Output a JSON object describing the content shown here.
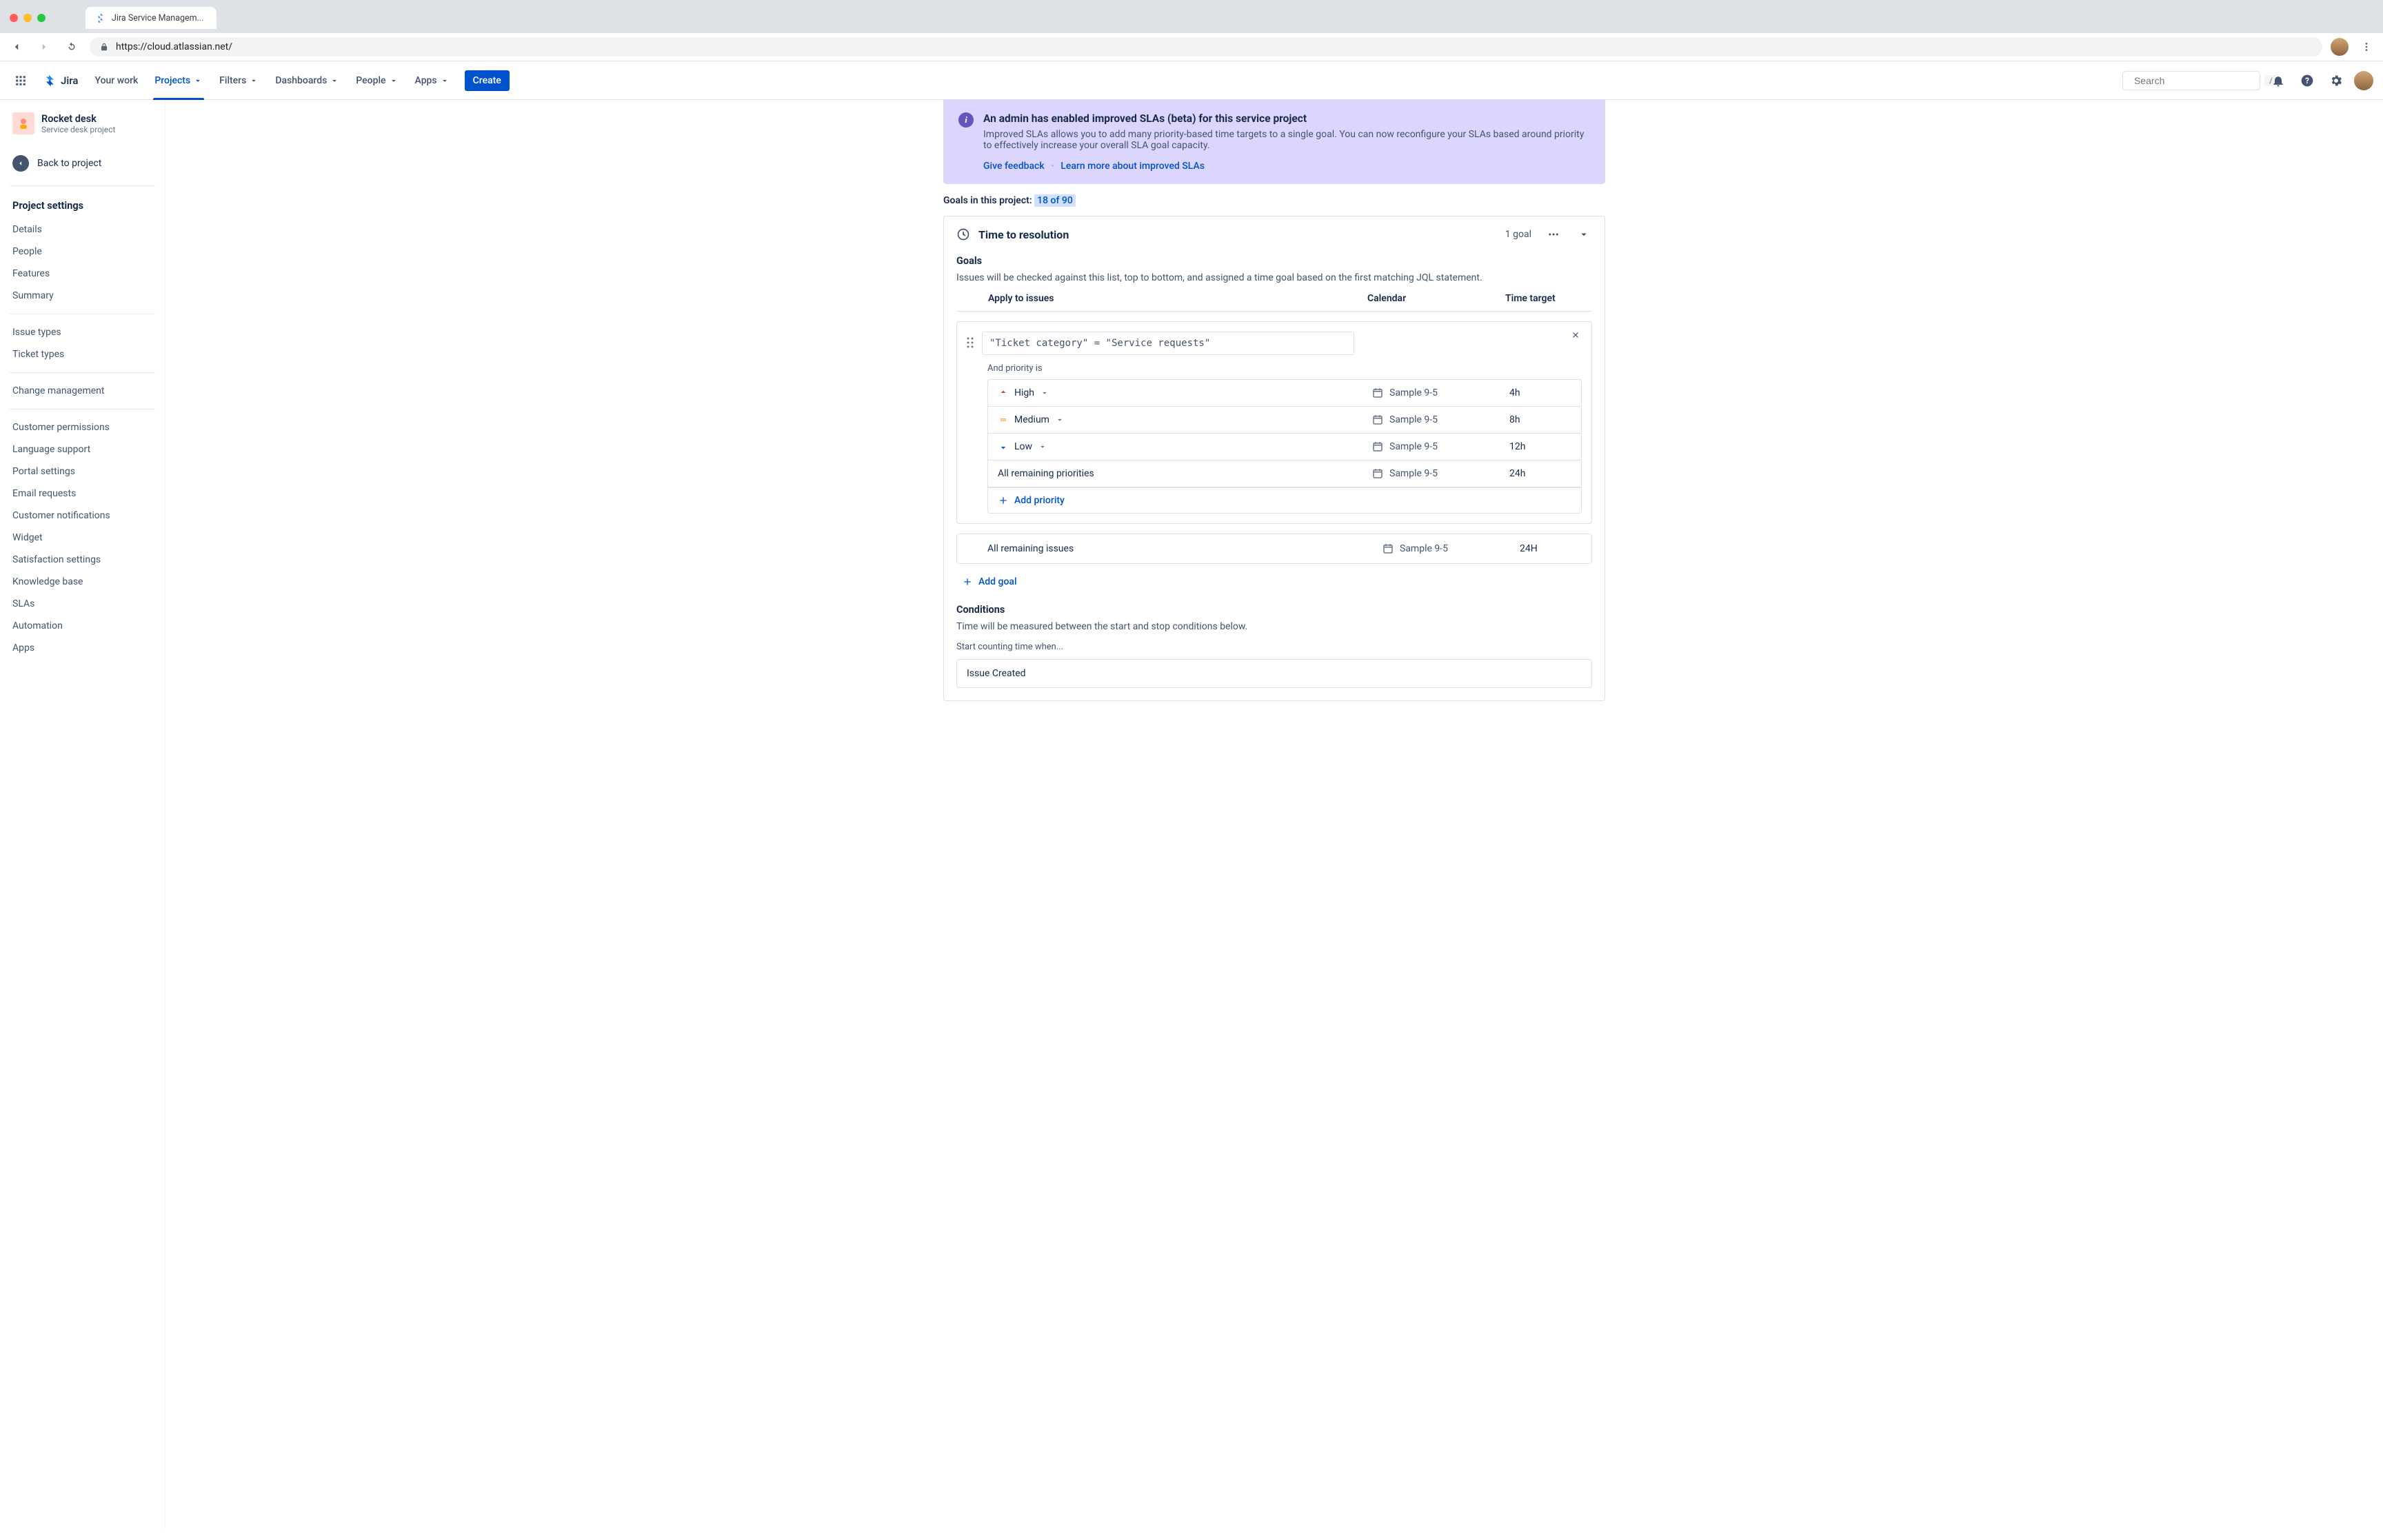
{
  "browser": {
    "tab_title": "Jira Service Managem...",
    "url": "https://cloud.atlassian.net/"
  },
  "topnav": {
    "logo": "Jira",
    "items": {
      "your_work": "Your work",
      "projects": "Projects",
      "filters": "Filters",
      "dashboards": "Dashboards",
      "people": "People",
      "apps": "Apps"
    },
    "create": "Create",
    "search_placeholder": "Search",
    "search_kbd": "/"
  },
  "sidebar": {
    "project": {
      "name": "Rocket desk",
      "sub": "Service desk project"
    },
    "back": "Back to project",
    "heading": "Project settings",
    "group1": [
      "Details",
      "People",
      "Features",
      "Summary"
    ],
    "group2": [
      "Issue types",
      "Ticket types"
    ],
    "group3": [
      "Change management"
    ],
    "group4": [
      "Customer permissions",
      "Language support",
      "Portal settings",
      "Email requests",
      "Customer notifications",
      "Widget",
      "Satisfaction settings",
      "Knowledge base",
      "SLAs",
      "Automation",
      "Apps"
    ]
  },
  "banner": {
    "title": "An admin has enabled improved SLAs (beta) for this service project",
    "body": "Improved SLAs allows you to add many priority-based time targets to a single goal. You can now reconfigure your SLAs based around priority to effectively increase your overall SLA goal capacity.",
    "feedback": "Give feedback",
    "learn": "Learn more about improved SLAs"
  },
  "goals_count": {
    "label": "Goals in this project:",
    "value": "18 of 90"
  },
  "panel": {
    "title": "Time to resolution",
    "goal_count": "1 goal",
    "goals_heading": "Goals",
    "goals_desc": "Issues will be checked against this list, top to bottom, and assigned a time goal based on the first matching JQL statement.",
    "cols": {
      "apply": "Apply to issues",
      "calendar": "Calendar",
      "target": "Time target"
    },
    "jql": "\"Ticket category\" = \"Service requests\"",
    "priority_label": "And priority is",
    "priorities": [
      {
        "name": "High",
        "icon": "high",
        "calendar": "Sample 9-5",
        "target": "4h"
      },
      {
        "name": "Medium",
        "icon": "medium",
        "calendar": "Sample 9-5",
        "target": "8h"
      },
      {
        "name": "Low",
        "icon": "low",
        "calendar": "Sample 9-5",
        "target": "12h"
      },
      {
        "name": "All remaining priorities",
        "icon": "none",
        "calendar": "Sample 9-5",
        "target": "24h"
      }
    ],
    "add_priority": "Add priority",
    "remaining": {
      "label": "All remaining issues",
      "calendar": "Sample 9-5",
      "target": "24H"
    },
    "add_goal": "Add goal",
    "conditions_heading": "Conditions",
    "conditions_desc": "Time will be measured between the start and stop conditions below.",
    "start_label": "Start counting time when...",
    "start_value": "Issue Created"
  }
}
